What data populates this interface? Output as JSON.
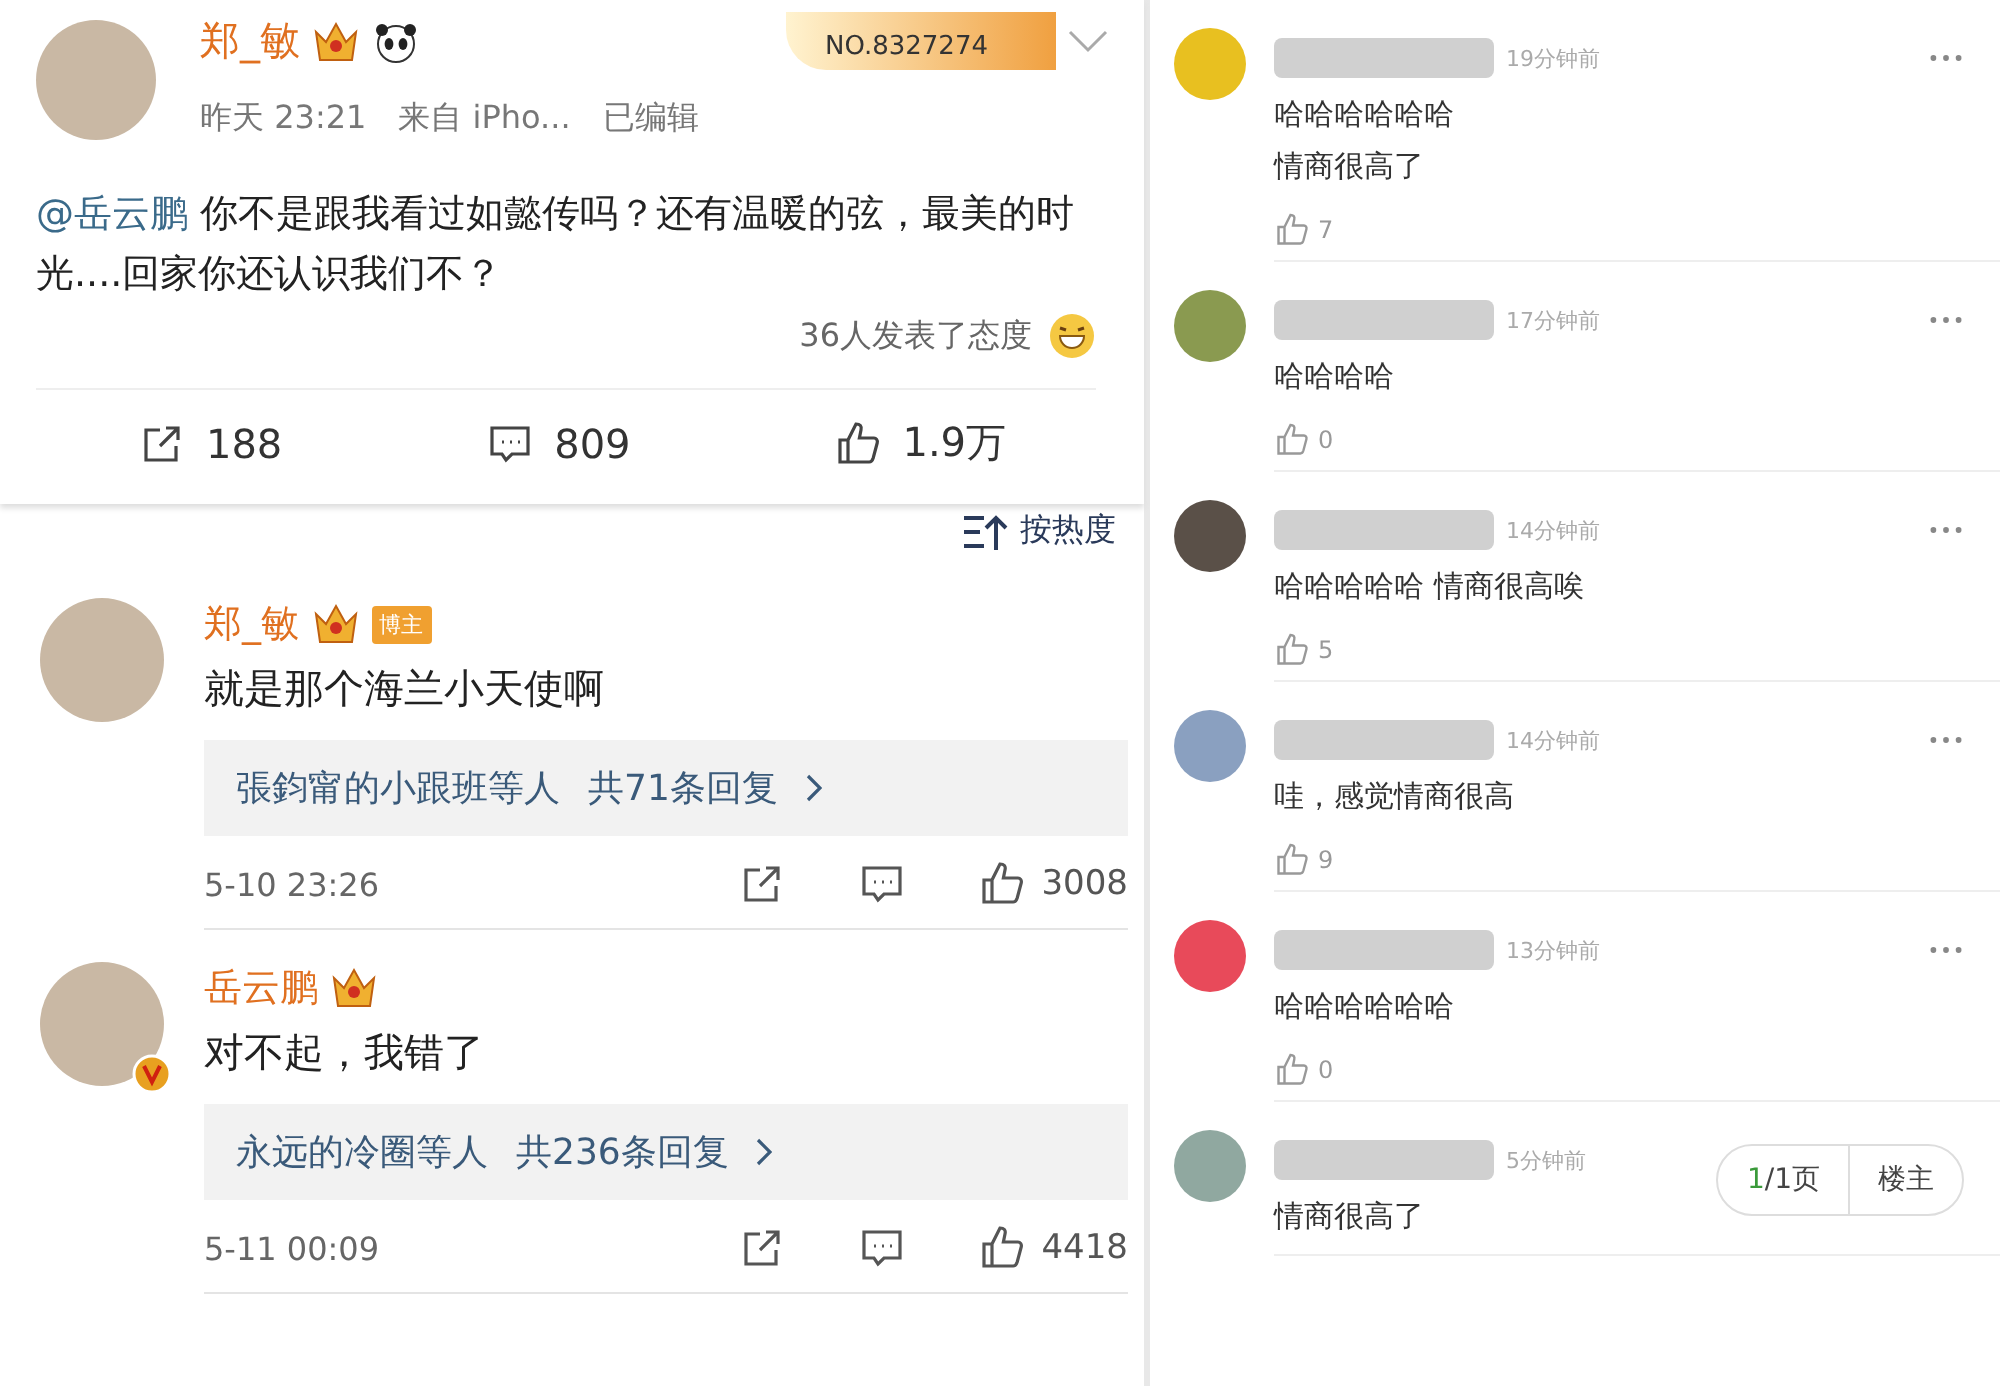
{
  "post": {
    "author": "郑_敏",
    "banner_number": "NO.8327274",
    "time": "昨天 23:21",
    "source": "来自 iPho...",
    "edited": "已编辑",
    "mention": "@岳云鹏",
    "text": " 你不是跟我看过如懿传吗？还有温暖的弦，最美的时光....回家你还认识我们不？",
    "reactions": "36人发表了态度",
    "reposts": "188",
    "comments": "809",
    "likes": "1.9万"
  },
  "sort": "按热度",
  "comments": [
    {
      "author": "郑_敏",
      "badge": "博主",
      "verified": false,
      "text": "就是那个海兰小天使啊",
      "replies_from": "張鈞甯的小跟班等人",
      "replies_count": "共71条回复",
      "time": "5-10 23:26",
      "likes": "3008"
    },
    {
      "author": "岳云鹏",
      "verified": true,
      "text": "对不起，我错了",
      "replies_from": "永远的冷圈等人",
      "replies_count": "共236条回复",
      "time": "5-11 00:09",
      "likes": "4418"
    }
  ],
  "right_comments": [
    {
      "color": "#e8c020",
      "time": "19分钟前",
      "lines": [
        "哈哈哈哈哈哈",
        "情商很高了"
      ],
      "likes": "7"
    },
    {
      "color": "#8a9a50",
      "time": "17分钟前",
      "lines": [
        "哈哈哈哈"
      ],
      "likes": "0"
    },
    {
      "color": "#5a5048",
      "time": "14分钟前",
      "lines": [
        "哈哈哈哈哈 情商很高唉"
      ],
      "likes": "5"
    },
    {
      "color": "#8aa0c0",
      "time": "14分钟前",
      "lines": [
        "哇，感觉情商很高"
      ],
      "likes": "9"
    },
    {
      "color": "#e84a5a",
      "time": "13分钟前",
      "lines": [
        "哈哈哈哈哈哈"
      ],
      "likes": "0"
    },
    {
      "color": "#90a8a0",
      "time": "5分钟前",
      "lines": [
        "情商很高了"
      ]
    }
  ],
  "pager": {
    "current": "1",
    "total": "/1页",
    "owner": "楼主"
  }
}
